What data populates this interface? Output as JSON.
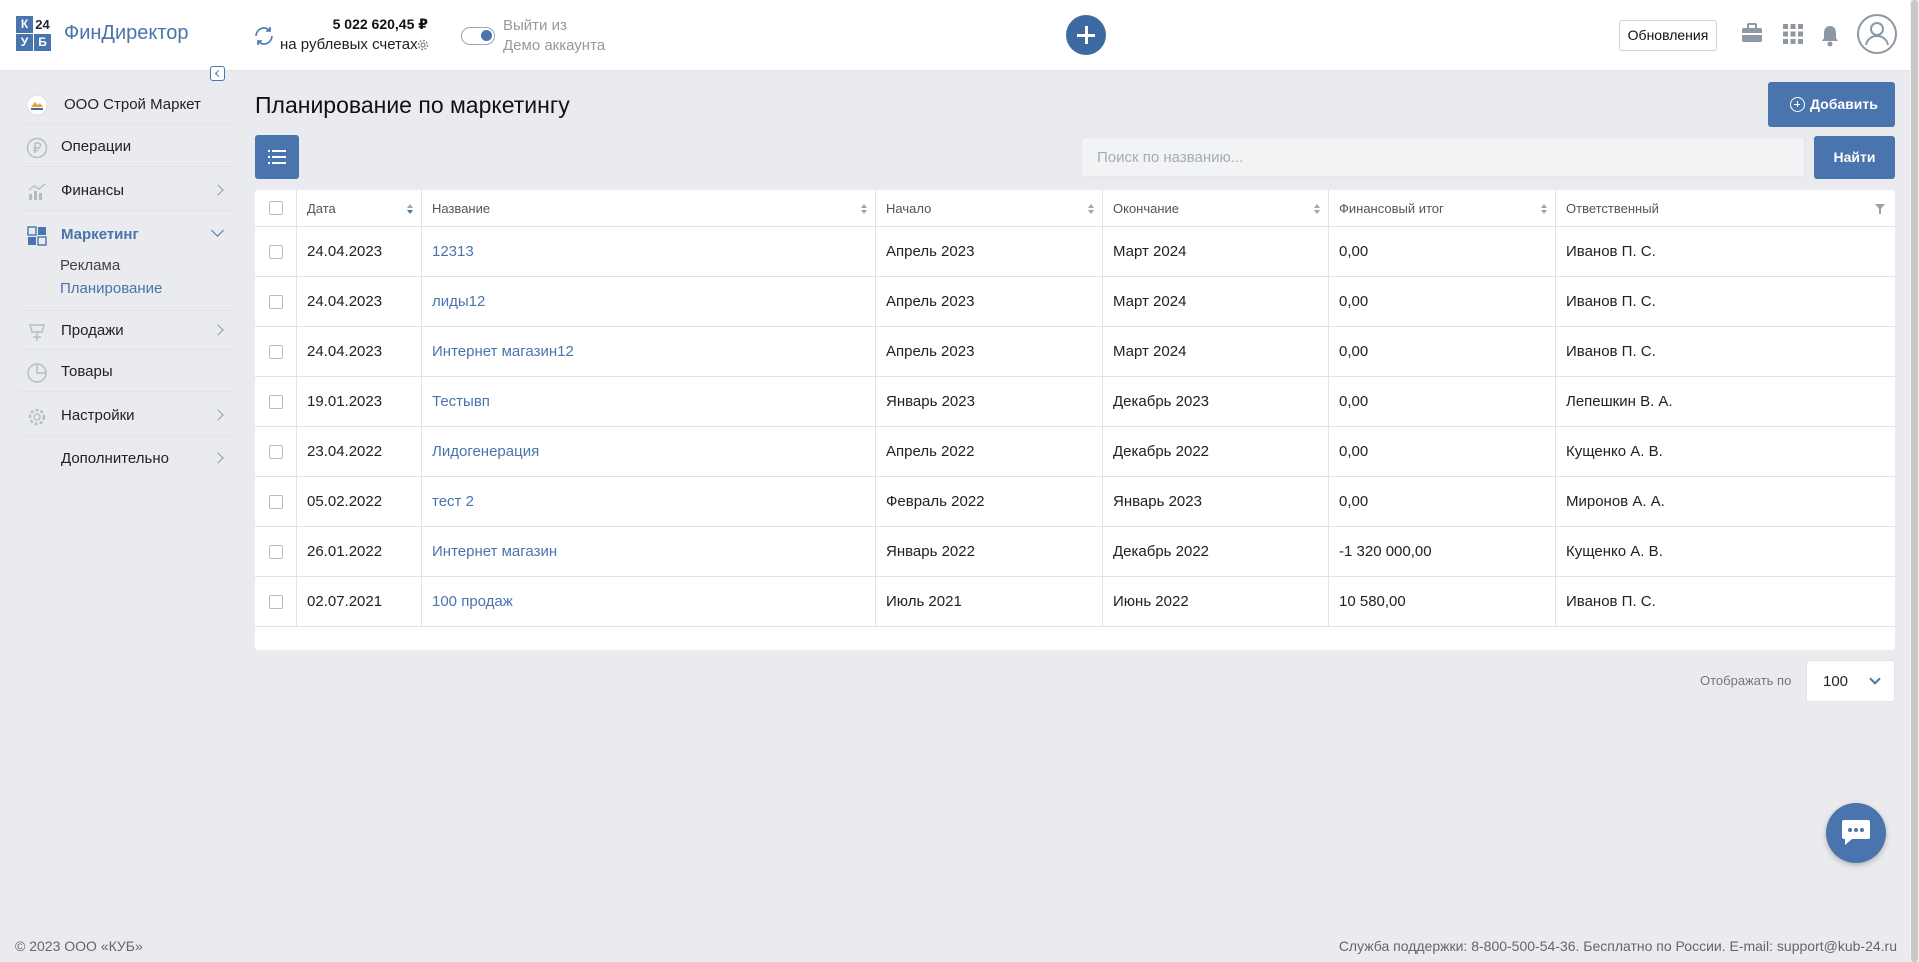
{
  "header": {
    "logo_cells": [
      "К",
      "24",
      "У",
      "Б"
    ],
    "logo_text": "ФинДиректор",
    "balance_amount": "5 022 620,45 ₽",
    "balance_sub": "на рублевых счетах",
    "demo_line1": "Выйти из",
    "demo_line2": "Демо аккаунта",
    "updates_label": "Обновления",
    "icons": [
      "sync-icon",
      "gear-icon",
      "add-icon",
      "briefcase-icon",
      "apps-grid-icon",
      "bell-icon",
      "user-avatar-icon"
    ]
  },
  "sidebar": {
    "company": "ООО Строй Маркет",
    "items": [
      {
        "label": "Операции",
        "icon": "ruble-icon"
      },
      {
        "label": "Финансы",
        "icon": "chart-icon"
      },
      {
        "label": "Маркетинг",
        "icon": "marketing-icon"
      },
      {
        "label": "Продажи",
        "icon": "sales-icon"
      },
      {
        "label": "Товары",
        "icon": "goods-icon"
      },
      {
        "label": "Настройки",
        "icon": "settings-icon"
      },
      {
        "label": "Дополнительно",
        "icon": ""
      }
    ],
    "marketing_sub": [
      "Реклама",
      "Планирование"
    ]
  },
  "main": {
    "title": "Планирование по маркетингу",
    "add_label": "Добавить",
    "search_placeholder": "Поиск по названию...",
    "find_label": "Найти",
    "columns": [
      "Дата",
      "Название",
      "Начало",
      "Окончание",
      "Финансовый итог",
      "Ответственный"
    ],
    "rows": [
      {
        "date": "24.04.2023",
        "name": "12313",
        "start": "Апрель 2023",
        "end": "Март 2024",
        "total": "0,00",
        "owner": "Иванов П. С."
      },
      {
        "date": "24.04.2023",
        "name": "лиды12",
        "start": "Апрель 2023",
        "end": "Март 2024",
        "total": "0,00",
        "owner": "Иванов П. С."
      },
      {
        "date": "24.04.2023",
        "name": "Интернет магазин12",
        "start": "Апрель 2023",
        "end": "Март 2024",
        "total": "0,00",
        "owner": "Иванов П. С."
      },
      {
        "date": "19.01.2023",
        "name": "Тестывп",
        "start": "Январь 2023",
        "end": "Декабрь 2023",
        "total": "0,00",
        "owner": "Лепешкин В. А."
      },
      {
        "date": "23.04.2022",
        "name": "Лидогенерация",
        "start": "Апрель 2022",
        "end": "Декабрь 2022",
        "total": "0,00",
        "owner": "Кущенко А. В."
      },
      {
        "date": "05.02.2022",
        "name": "тест 2",
        "start": "Февраль 2022",
        "end": "Январь 2023",
        "total": "0,00",
        "owner": "Миронов А. А."
      },
      {
        "date": "26.01.2022",
        "name": "Интернет магазин",
        "start": "Январь 2022",
        "end": "Декабрь 2022",
        "total": "-1 320 000,00",
        "owner": "Кущенко А. В."
      },
      {
        "date": "02.07.2021",
        "name": "100 продаж",
        "start": "Июль 2021",
        "end": "Июнь 2022",
        "total": "10 580,00",
        "owner": "Иванов П. С."
      }
    ],
    "per_page_label": "Отображать по",
    "per_page_value": "100"
  },
  "footer": {
    "copyright": "© 2023 ООО «КУБ»",
    "support": "Служба поддержки: 8-800-500-54-36. Бесплатно по России. E-mail: support@kub-24.ru"
  },
  "colors": {
    "accent": "#4a74ad",
    "logo_blue": "#4a74ad",
    "logo_dark": "#1e2a3a",
    "background": "#e9ebee"
  }
}
